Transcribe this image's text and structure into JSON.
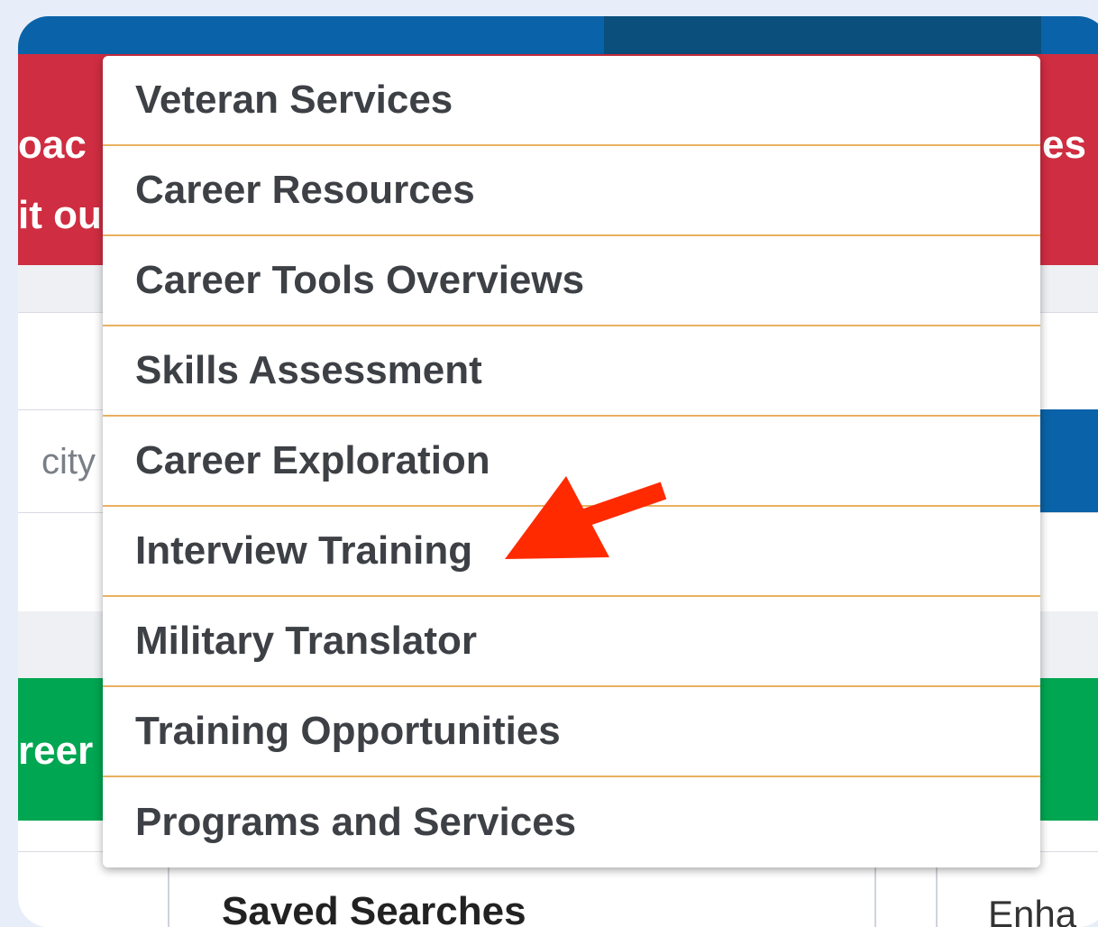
{
  "background_fragments": {
    "red_left_line1": "oac",
    "red_left_line2": "it ou",
    "red_right_line1": "es",
    "search_placeholder_fragment": "city",
    "green_left_text": "reer",
    "saved_searches_label": "Saved Searches",
    "right_panel_fragment": "Enha"
  },
  "dropdown": {
    "items": [
      {
        "label": "Veteran Services"
      },
      {
        "label": "Career Resources"
      },
      {
        "label": "Career Tools Overviews"
      },
      {
        "label": "Skills Assessment"
      },
      {
        "label": "Career Exploration"
      },
      {
        "label": "Interview Training"
      },
      {
        "label": "Military Translator"
      },
      {
        "label": "Training Opportunities"
      },
      {
        "label": "Programs and Services"
      }
    ]
  },
  "annotation": {
    "arrow_icon": "red-arrow-icon",
    "color": "#ff2a00",
    "points_to": "Interview Training"
  },
  "colors": {
    "header_blue": "#0a63a8",
    "header_dark_blue": "#0b4f7d",
    "banner_red": "#cf2d41",
    "banner_green": "#00a651",
    "menu_divider": "#e8b160",
    "menu_text": "#3d4045"
  }
}
